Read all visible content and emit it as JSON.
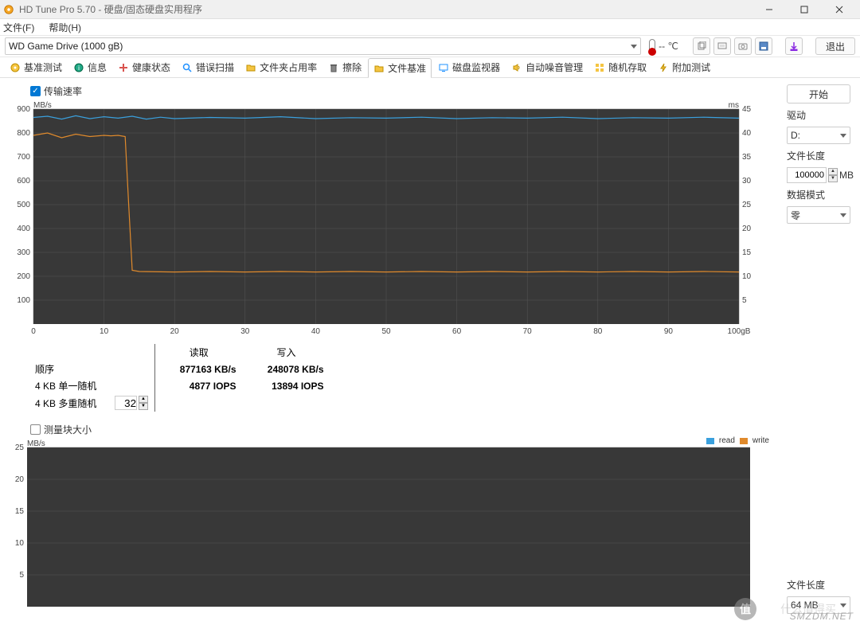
{
  "window": {
    "title": "HD Tune Pro 5.70 - 硬盘/固态硬盘实用程序"
  },
  "menubar": {
    "file": "文件(F)",
    "help": "帮助(H)"
  },
  "toolbar": {
    "drive": "WD    Game Drive (1000 gB)",
    "temperature": "-- ℃",
    "exit": "退出"
  },
  "tabs": [
    {
      "label": "基准测试",
      "icon": "disc-icon",
      "color": "#e6b800"
    },
    {
      "label": "信息",
      "icon": "info-icon",
      "color": "#1e90ff"
    },
    {
      "label": "健康状态",
      "icon": "plus-icon",
      "color": "#d9534f"
    },
    {
      "label": "错误扫描",
      "icon": "search-icon",
      "color": "#1e90ff"
    },
    {
      "label": "文件夹占用率",
      "icon": "folder-icon",
      "color": "#e6b800"
    },
    {
      "label": "擦除",
      "icon": "trash-icon",
      "color": "#555"
    },
    {
      "label": "文件基准",
      "icon": "folder-icon",
      "color": "#e6b800",
      "active": true
    },
    {
      "label": "磁盘监视器",
      "icon": "monitor-icon",
      "color": "#1e90ff"
    },
    {
      "label": "自动噪音管理",
      "icon": "speaker-icon",
      "color": "#e6b800"
    },
    {
      "label": "随机存取",
      "icon": "grid-icon",
      "color": "#e6b800"
    },
    {
      "label": "附加测试",
      "icon": "bolt-icon",
      "color": "#e6b800"
    }
  ],
  "section1": {
    "checkbox_label": "传输速率",
    "checked": true
  },
  "chart_data": [
    {
      "type": "line",
      "title": "",
      "xlabel": "",
      "ylabel_left": "MB/s",
      "ylabel_right": "ms",
      "xlim": [
        0,
        100
      ],
      "xunit": "gB",
      "ylim_left": [
        0,
        900
      ],
      "ylim_right": [
        0,
        45
      ],
      "x_ticks": [
        0,
        10,
        20,
        30,
        40,
        50,
        60,
        70,
        80,
        90,
        100
      ],
      "y_ticks_left": [
        100,
        200,
        300,
        400,
        500,
        600,
        700,
        800,
        900
      ],
      "y_ticks_right": [
        5,
        10,
        15,
        20,
        25,
        30,
        35,
        40,
        45
      ],
      "series": [
        {
          "name": "read",
          "color": "#3aa0dd",
          "axis": "left",
          "x": [
            0,
            2,
            4,
            6,
            8,
            10,
            12,
            14,
            16,
            18,
            20,
            25,
            30,
            35,
            40,
            45,
            50,
            55,
            60,
            65,
            70,
            75,
            80,
            85,
            90,
            95,
            100
          ],
          "values": [
            865,
            870,
            858,
            872,
            860,
            868,
            862,
            870,
            858,
            866,
            860,
            865,
            862,
            868,
            860,
            864,
            862,
            866,
            860,
            864,
            862,
            866,
            860,
            864,
            862,
            866,
            862
          ]
        },
        {
          "name": "write",
          "color": "#e08a2c",
          "axis": "left",
          "x": [
            0,
            2,
            4,
            6,
            8,
            10,
            11,
            12,
            13,
            13.5,
            14,
            15,
            20,
            25,
            30,
            35,
            40,
            45,
            50,
            55,
            60,
            65,
            70,
            75,
            80,
            85,
            90,
            95,
            100
          ],
          "values": [
            790,
            800,
            780,
            795,
            785,
            790,
            788,
            790,
            785,
            500,
            225,
            220,
            218,
            220,
            218,
            220,
            218,
            220,
            218,
            220,
            218,
            220,
            218,
            220,
            218,
            220,
            218,
            220,
            218
          ]
        }
      ]
    },
    {
      "type": "line",
      "title": "",
      "xlabel": "",
      "ylabel_left": "MB/s",
      "xlim": [
        0,
        100
      ],
      "ylim_left": [
        0,
        25
      ],
      "x_ticks": [],
      "y_ticks_left": [
        5,
        10,
        15,
        20,
        25
      ],
      "legend": [
        {
          "name": "read",
          "color": "#3aa0dd"
        },
        {
          "name": "write",
          "color": "#e08a2c"
        }
      ],
      "series": []
    }
  ],
  "stats": {
    "col_read": "读取",
    "col_write": "写入",
    "rows": [
      {
        "label": "顺序",
        "read": "877163 KB/s",
        "write": "248078 KB/s"
      },
      {
        "label": "4 KB 单一随机",
        "read": "4877 IOPS",
        "write": "13894 IOPS"
      },
      {
        "label": "4 KB 多重随机",
        "read": "",
        "write": ""
      }
    ],
    "spinner_value": "32"
  },
  "section2": {
    "checkbox_label": "测量块大小",
    "checked": false
  },
  "side": {
    "start": "开始",
    "drive_label": "驱动",
    "drive_value": "D:",
    "filelen_label": "文件长度",
    "filelen_value": "100000",
    "filelen_unit": "MB",
    "mode_label": "数据模式",
    "mode_value": "零",
    "filelen2_label": "文件长度",
    "filelen2_value": "64 MB"
  },
  "watermark": "SMZDM.NET"
}
